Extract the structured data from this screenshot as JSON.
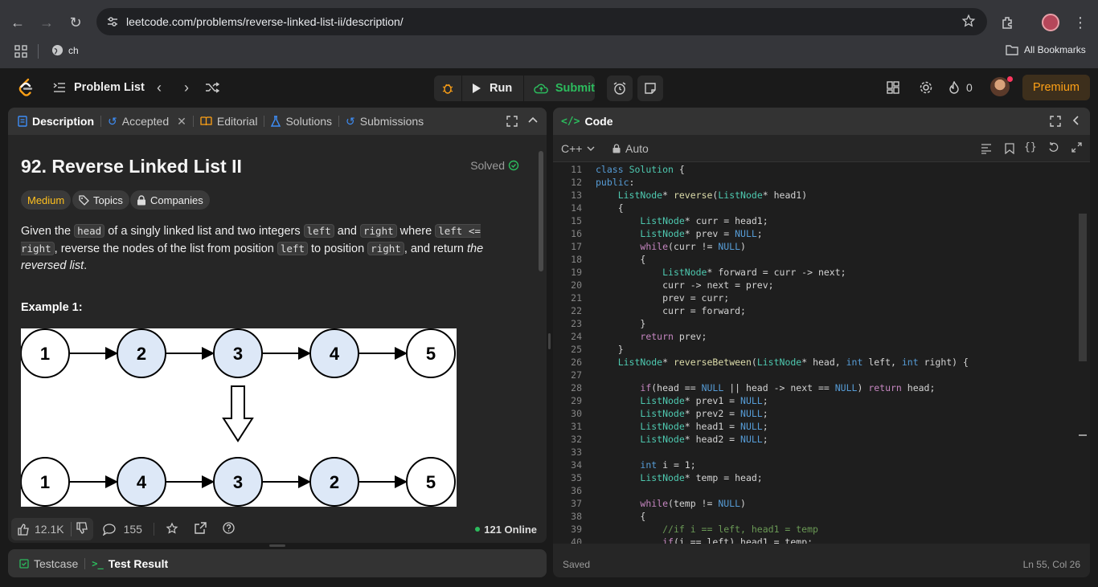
{
  "browser": {
    "url": "leetcode.com/problems/reverse-linked-list-ii/description/",
    "bookmark_folder_label": "ch",
    "all_bookmarks_label": "All Bookmarks"
  },
  "header": {
    "problem_list_label": "Problem List",
    "run_label": "Run",
    "submit_label": "Submit",
    "streak_count": "0",
    "premium_label": "Premium",
    "colors": {
      "submit": "#2cbb5d",
      "premium": "#ffa116",
      "bg": "#1a1a1a"
    }
  },
  "desc_tabs": {
    "description": "Description",
    "accepted": "Accepted",
    "editorial": "Editorial",
    "solutions": "Solutions",
    "submissions": "Submissions"
  },
  "problem": {
    "title": "92. Reverse Linked List II",
    "status": "Solved",
    "difficulty": "Medium",
    "topics_label": "Topics",
    "companies_label": "Companies",
    "statement": {
      "p1": "Given the ",
      "c1": "head",
      "p2": " of a singly linked list and two integers ",
      "c2": "left",
      "p3": " and ",
      "c3": "right",
      "p4": " where ",
      "c4": "left <= right",
      "p5": ", reverse the nodes of the list from position ",
      "c5": "left",
      "p6": " to position ",
      "c6": "right",
      "p7": ", and return ",
      "em": "the reversed list",
      "p8": "."
    },
    "example_title": "Example 1:",
    "example_top": [
      "1",
      "2",
      "3",
      "4",
      "5"
    ],
    "example_bottom": [
      "1",
      "4",
      "3",
      "2",
      "5"
    ]
  },
  "desc_footer": {
    "likes": "12.1K",
    "comments": "155",
    "online": "121 Online"
  },
  "test_tabs": {
    "testcase": "Testcase",
    "test_result": "Test Result"
  },
  "code_panel": {
    "title": "Code",
    "language": "C++",
    "mode": "Auto",
    "saved": "Saved",
    "cursor": "Ln 55, Col 26"
  },
  "code_lines": [
    {
      "n": "11",
      "t": "class Solution {"
    },
    {
      "n": "12",
      "t": "public:"
    },
    {
      "n": "13",
      "t": "    ListNode* reverse(ListNode* head1)"
    },
    {
      "n": "14",
      "t": "    {"
    },
    {
      "n": "15",
      "t": "        ListNode* curr = head1;"
    },
    {
      "n": "16",
      "t": "        ListNode* prev = NULL;"
    },
    {
      "n": "17",
      "t": "        while(curr != NULL)"
    },
    {
      "n": "18",
      "t": "        {"
    },
    {
      "n": "19",
      "t": "            ListNode* forward = curr -> next;"
    },
    {
      "n": "20",
      "t": "            curr -> next = prev;"
    },
    {
      "n": "21",
      "t": "            prev = curr;"
    },
    {
      "n": "22",
      "t": "            curr = forward;"
    },
    {
      "n": "23",
      "t": "        }"
    },
    {
      "n": "24",
      "t": "        return prev;"
    },
    {
      "n": "25",
      "t": "    }"
    },
    {
      "n": "26",
      "t": "    ListNode* reverseBetween(ListNode* head, int left, int right) {"
    },
    {
      "n": "27",
      "t": ""
    },
    {
      "n": "28",
      "t": "        if(head == NULL || head -> next == NULL) return head;"
    },
    {
      "n": "29",
      "t": "        ListNode* prev1 = NULL;"
    },
    {
      "n": "30",
      "t": "        ListNode* prev2 = NULL;"
    },
    {
      "n": "31",
      "t": "        ListNode* head1 = NULL;"
    },
    {
      "n": "32",
      "t": "        ListNode* head2 = NULL;"
    },
    {
      "n": "33",
      "t": ""
    },
    {
      "n": "34",
      "t": "        int i = 1;"
    },
    {
      "n": "35",
      "t": "        ListNode* temp = head;"
    },
    {
      "n": "36",
      "t": ""
    },
    {
      "n": "37",
      "t": "        while(temp != NULL)"
    },
    {
      "n": "38",
      "t": "        {"
    },
    {
      "n": "39",
      "t": "            //if i == left, head1 = temp"
    },
    {
      "n": "40",
      "t": "            if(i == left) head1 = temp;"
    }
  ]
}
